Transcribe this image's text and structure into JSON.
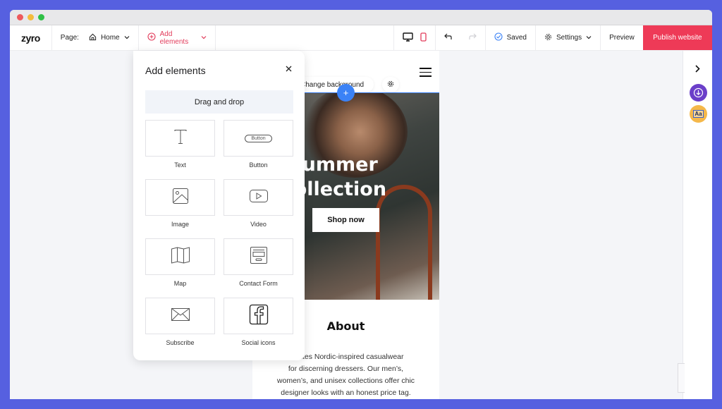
{
  "toolbar": {
    "logo": "zyro",
    "page_label": "Page:",
    "page_value": "Home",
    "add_elements": "Add elements",
    "saved": "Saved",
    "settings": "Settings",
    "preview": "Preview",
    "publish": "Publish website"
  },
  "panel": {
    "title": "Add elements",
    "drag_drop": "Drag and drop",
    "items": [
      {
        "label": "Text",
        "icon": "text-icon"
      },
      {
        "label": "Button",
        "icon": "button-icon",
        "icon_text": "Button"
      },
      {
        "label": "Image",
        "icon": "image-icon"
      },
      {
        "label": "Video",
        "icon": "video-icon"
      },
      {
        "label": "Map",
        "icon": "map-icon"
      },
      {
        "label": "Contact Form",
        "icon": "contact-form-icon"
      },
      {
        "label": "Subscribe",
        "icon": "envelope-icon"
      },
      {
        "label": "Social icons",
        "icon": "facebook-icon"
      }
    ]
  },
  "site": {
    "change_background": "Change background",
    "hero_title_1": "Summer",
    "hero_title_2": "Collection",
    "hero_button": "Shop now",
    "about_title": "About",
    "about_lines": [
      "...eates Nordic-inspired casualwear",
      "for discerning dressers. Our men’s,",
      "women’s, and unisex collections offer chic",
      "designer looks with an honest price tag."
    ]
  },
  "colors": {
    "accent": "#e23c5b",
    "publish": "#ee3a57",
    "selection_blue": "#3b82f6",
    "frame": "#5660e0"
  }
}
